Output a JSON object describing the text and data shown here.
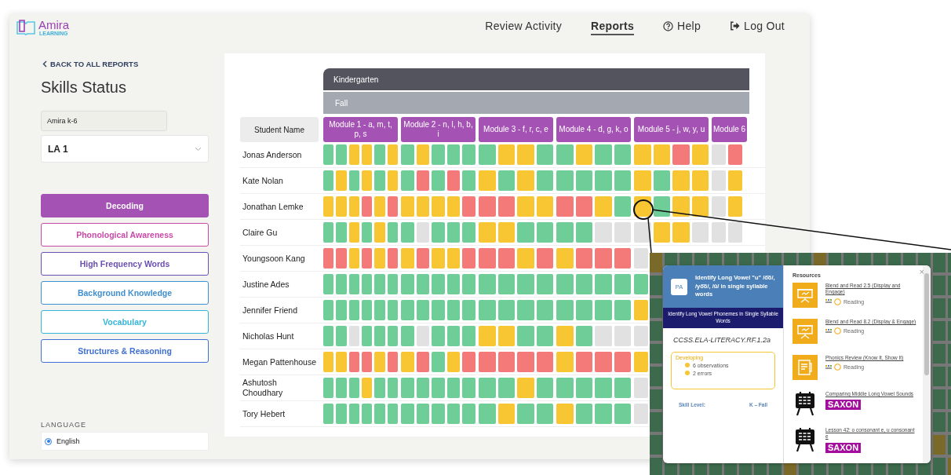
{
  "logo": {
    "name": "Amira",
    "tagline": "LEARNING"
  },
  "nav": [
    {
      "label": "Review Activity",
      "kind": "text",
      "selected": false
    },
    {
      "label": "Reports",
      "kind": "text",
      "selected": true
    },
    {
      "label": "Help",
      "kind": "help",
      "selected": false
    },
    {
      "label": "Log Out",
      "kind": "logout",
      "selected": false
    }
  ],
  "sidebar": {
    "back_link": "BACK TO ALL REPORTS",
    "title": "Skills Status",
    "program_field": "Amira k-6",
    "class_select": "LA 1",
    "skills": [
      {
        "label": "Decoding",
        "color": "#a552b5",
        "selected": true
      },
      {
        "label": "Phonological Awareness",
        "color": "#c94aa8",
        "selected": false
      },
      {
        "label": "High Frequency Words",
        "color": "#6a4fb0",
        "selected": false
      },
      {
        "label": "Background Knowledge",
        "color": "#3f8fd0",
        "selected": false
      },
      {
        "label": "Vocabulary",
        "color": "#35b5d8",
        "selected": false
      },
      {
        "label": "Structures & Reasoning",
        "color": "#3f6fd0",
        "selected": false
      }
    ],
    "language": {
      "label": "LANGUAGE",
      "options": [
        {
          "label": "English",
          "selected": true
        }
      ]
    }
  },
  "grid": {
    "grade": "Kindergarten",
    "season": "Fall",
    "name_header": "Student Name",
    "modules": [
      "Module 1 - a, m, t, p, s",
      "Module 2 - n, l, h, b, i",
      "Module 3 - f, r, c, e",
      "Module 4 - d, g, k, o",
      "Module 5 - j, w, y, u",
      "Module 6"
    ],
    "rows": [
      {
        "name": "Jonas Anderson",
        "cells": [
          [
            {
              "color": "#6fcd98"
            },
            {
              "color": "#6fcd98"
            },
            {
              "color": "#f8c633"
            },
            {
              "color": "#f8c633"
            },
            {
              "color": "#6fcd98"
            },
            {
              "color": "#f8c633"
            }
          ],
          [
            {
              "color": "#6fcd98"
            },
            {
              "color": "#f8c633"
            },
            {
              "color": "#6fcd98"
            },
            {
              "color": "#6fcd98"
            },
            {
              "color": "#6fcd98"
            }
          ],
          [
            {
              "color": "#6fcd98"
            },
            {
              "color": "#f8c633"
            },
            {
              "color": "#f8c633"
            },
            {
              "color": "#6fcd98"
            }
          ],
          [
            {
              "color": "#6fcd98"
            },
            {
              "color": "#f8c633"
            },
            {
              "color": "#6fcd98"
            },
            {
              "color": "#6fcd98"
            }
          ],
          [
            {
              "color": "#f8c633"
            },
            {
              "color": "#f8c633"
            },
            {
              "color": "#f47a7a"
            },
            {
              "color": "#f8c633"
            }
          ],
          [
            {
              "color": "#e1e1e1"
            },
            {
              "color": "#f47a7a"
            }
          ]
        ]
      },
      {
        "name": "Kate Nolan",
        "cells": [
          [
            {
              "color": "#6fcd98"
            },
            {
              "color": "#f8c633"
            },
            {
              "color": "#6fcd98"
            },
            {
              "color": "#f8c633"
            },
            {
              "color": "#6fcd98"
            },
            {
              "color": "#f8c633"
            }
          ],
          [
            {
              "color": "#6fcd98"
            },
            {
              "color": "#f47a7a"
            },
            {
              "color": "#6fcd98"
            },
            {
              "color": "#f47a7a"
            },
            {
              "color": "#6fcd98"
            }
          ],
          [
            {
              "color": "#f8c633"
            },
            {
              "color": "#6fcd98"
            },
            {
              "color": "#f8c633"
            },
            {
              "color": "#6fcd98"
            }
          ],
          [
            {
              "color": "#6fcd98"
            },
            {
              "color": "#6fcd98"
            },
            {
              "color": "#6fcd98"
            },
            {
              "color": "#6fcd98"
            }
          ],
          [
            {
              "color": "#f8c633"
            },
            {
              "color": "#6fcd98"
            },
            {
              "color": "#f8c633"
            },
            {
              "color": "#f8c633"
            }
          ],
          [
            {
              "color": "#e1e1e1"
            },
            {
              "color": "#f8c633"
            }
          ]
        ]
      },
      {
        "name": "Jonathan Lemke",
        "cells": [
          [
            {
              "color": "#f8c633"
            },
            {
              "color": "#f8c633"
            },
            {
              "color": "#f8c633"
            },
            {
              "color": "#f47a7a"
            },
            {
              "color": "#f8c633"
            },
            {
              "color": "#f47a7a"
            }
          ],
          [
            {
              "color": "#f8c633"
            },
            {
              "color": "#f8c633"
            },
            {
              "color": "#f8c633"
            },
            {
              "color": "#f8c633"
            },
            {
              "color": "#f47a7a"
            }
          ],
          [
            {
              "color": "#f47a7a"
            },
            {
              "color": "#f47a7a"
            },
            {
              "color": "#f8c633"
            },
            {
              "color": "#f8c633"
            }
          ],
          [
            {
              "color": "#f47a7a"
            },
            {
              "color": "#f47a7a"
            },
            {
              "color": "#f8c633"
            },
            {
              "color": "#6fcd98"
            }
          ],
          [
            {
              "color": "#f8c633"
            },
            {
              "color": "#6fcd98"
            },
            {
              "color": "#f8c633"
            },
            {
              "color": "#f8c633"
            }
          ],
          [
            {
              "color": "#e1e1e1"
            },
            {
              "color": "#f8c633"
            }
          ]
        ]
      },
      {
        "name": "Claire Gu",
        "cells": [
          [
            {
              "color": "#6fcd98"
            },
            {
              "color": "#6fcd98"
            },
            {
              "color": "#f8c633"
            },
            {
              "color": "#6fcd98"
            },
            {
              "color": "#f8c633"
            },
            {
              "color": "#6fcd98"
            }
          ],
          [
            {
              "color": "#6fcd98"
            },
            {
              "color": "#e1e1e1"
            },
            {
              "color": "#6fcd98"
            },
            {
              "color": "#6fcd98"
            },
            {
              "color": "#6fcd98"
            }
          ],
          [
            {
              "color": "#f8c633"
            },
            {
              "color": "#f8c633"
            },
            {
              "color": "#6fcd98"
            },
            {
              "color": "#6fcd98"
            }
          ],
          [
            {
              "color": "#6fcd98"
            },
            {
              "color": "#6fcd98"
            },
            {
              "color": "#e1e1e1"
            },
            {
              "color": "#e1e1e1"
            }
          ],
          [
            {
              "color": "#e1e1e1"
            },
            {
              "color": "#f8c633"
            },
            {
              "color": "#f8c633"
            },
            {
              "color": "#e1e1e1"
            }
          ],
          [
            {
              "color": "#e1e1e1"
            },
            {
              "color": "#e1e1e1"
            }
          ]
        ]
      },
      {
        "name": "Youngsoon Kang",
        "cells": [
          [
            {
              "color": "#f47a7a"
            },
            {
              "color": "#f47a7a"
            },
            {
              "color": "#f8c633"
            },
            {
              "color": "#f47a7a"
            },
            {
              "color": "#f8c633"
            },
            {
              "color": "#f47a7a"
            }
          ],
          [
            {
              "color": "#f8c633"
            },
            {
              "color": "#f47a7a"
            },
            {
              "color": "#f8c633"
            },
            {
              "color": "#f8c633"
            },
            {
              "color": "#f47a7a"
            }
          ],
          [
            {
              "color": "#f47a7a"
            },
            {
              "color": "#f47a7a"
            },
            {
              "color": "#f8c633"
            },
            {
              "color": "#f47a7a"
            }
          ],
          [
            {
              "color": "#f8c633"
            },
            {
              "color": "#f47a7a"
            },
            {
              "color": "#f47a7a"
            },
            {
              "color": "#f47a7a"
            }
          ],
          [
            {
              "color": "#e1e1e1"
            }
          ]
        ]
      },
      {
        "name": "Justine Ades",
        "cells": [
          [
            {
              "color": "#6fcd98"
            },
            {
              "color": "#6fcd98"
            },
            {
              "color": "#6fcd98"
            },
            {
              "color": "#6fcd98"
            },
            {
              "color": "#6fcd98"
            },
            {
              "color": "#6fcd98"
            }
          ],
          [
            {
              "color": "#6fcd98"
            },
            {
              "color": "#6fcd98"
            },
            {
              "color": "#6fcd98"
            },
            {
              "color": "#6fcd98"
            },
            {
              "color": "#6fcd98"
            }
          ],
          [
            {
              "color": "#6fcd98"
            },
            {
              "color": "#6fcd98"
            },
            {
              "color": "#6fcd98"
            },
            {
              "color": "#6fcd98"
            }
          ],
          [
            {
              "color": "#6fcd98"
            },
            {
              "color": "#6fcd98"
            },
            {
              "color": "#6fcd98"
            },
            {
              "color": "#6fcd98"
            }
          ],
          [
            {
              "color": "#6fcd98"
            }
          ]
        ]
      },
      {
        "name": "Jennifer Friend",
        "cells": [
          [
            {
              "color": "#6fcd98"
            },
            {
              "color": "#6fcd98"
            },
            {
              "color": "#6fcd98"
            },
            {
              "color": "#6fcd98"
            },
            {
              "color": "#6fcd98"
            },
            {
              "color": "#6fcd98"
            }
          ],
          [
            {
              "color": "#6fcd98"
            },
            {
              "color": "#6fcd98"
            },
            {
              "color": "#6fcd98"
            },
            {
              "color": "#6fcd98"
            },
            {
              "color": "#6fcd98"
            }
          ],
          [
            {
              "color": "#6fcd98"
            },
            {
              "color": "#6fcd98"
            },
            {
              "color": "#6fcd98"
            },
            {
              "color": "#6fcd98"
            }
          ],
          [
            {
              "color": "#6fcd98"
            },
            {
              "color": "#6fcd98"
            },
            {
              "color": "#6fcd98"
            },
            {
              "color": "#6fcd98"
            }
          ],
          [
            {
              "color": "#f8c633"
            }
          ]
        ]
      },
      {
        "name": "Nicholas Hunt",
        "cells": [
          [
            {
              "color": "#6fcd98"
            },
            {
              "color": "#6fcd98"
            },
            {
              "color": "#e1e1e1"
            },
            {
              "color": "#6fcd98"
            },
            {
              "color": "#6fcd98"
            },
            {
              "color": "#6fcd98"
            }
          ],
          [
            {
              "color": "#6fcd98"
            },
            {
              "color": "#e1e1e1"
            },
            {
              "color": "#6fcd98"
            },
            {
              "color": "#6fcd98"
            },
            {
              "color": "#6fcd98"
            }
          ],
          [
            {
              "color": "#f8c633"
            },
            {
              "color": "#f8c633"
            },
            {
              "color": "#6fcd98"
            },
            {
              "color": "#6fcd98"
            }
          ],
          [
            {
              "color": "#f8c633"
            },
            {
              "color": "#6fcd98"
            },
            {
              "color": "#e1e1e1"
            },
            {
              "color": "#e1e1e1"
            }
          ],
          [
            {
              "color": "#e1e1e1"
            }
          ]
        ]
      },
      {
        "name": "Megan Pattenhouse",
        "cells": [
          [
            {
              "color": "#f8c633"
            },
            {
              "color": "#f8c633"
            },
            {
              "color": "#f47a7a"
            },
            {
              "color": "#f47a7a"
            },
            {
              "color": "#f8c633"
            },
            {
              "color": "#f47a7a"
            }
          ],
          [
            {
              "color": "#f8c633"
            },
            {
              "color": "#f47a7a"
            },
            {
              "color": "#6fcd98"
            },
            {
              "color": "#f8c633"
            },
            {
              "color": "#f47a7a"
            }
          ],
          [
            {
              "color": "#f47a7a"
            },
            {
              "color": "#f47a7a"
            },
            {
              "color": "#f47a7a"
            },
            {
              "color": "#f47a7a"
            }
          ],
          [
            {
              "color": "#f8c633"
            },
            {
              "color": "#f47a7a"
            },
            {
              "color": "#f47a7a"
            },
            {
              "color": "#f47a7a"
            }
          ],
          [
            {
              "color": "#f8c633"
            }
          ]
        ]
      },
      {
        "name": "Ashutosh Choudhary",
        "cells": [
          [
            {
              "color": "#6fcd98"
            },
            {
              "color": "#6fcd98"
            },
            {
              "color": "#6fcd98"
            },
            {
              "color": "#f8c633"
            },
            {
              "color": "#6fcd98"
            },
            {
              "color": "#6fcd98"
            }
          ],
          [
            {
              "color": "#6fcd98"
            },
            {
              "color": "#6fcd98"
            },
            {
              "color": "#6fcd98"
            },
            {
              "color": "#6fcd98"
            },
            {
              "color": "#6fcd98"
            }
          ],
          [
            {
              "color": "#6fcd98"
            },
            {
              "color": "#6fcd98"
            },
            {
              "color": "#f8c633"
            },
            {
              "color": "#6fcd98"
            }
          ],
          [
            {
              "color": "#6fcd98"
            },
            {
              "color": "#6fcd98"
            },
            {
              "color": "#6fcd98"
            },
            {
              "color": "#6fcd98"
            }
          ],
          [
            {
              "color": "#e1e1e1"
            }
          ]
        ]
      },
      {
        "name": "Tory Hebert",
        "cells": [
          [
            {
              "color": "#6fcd98"
            },
            {
              "color": "#6fcd98"
            },
            {
              "color": "#6fcd98"
            },
            {
              "color": "#6fcd98"
            },
            {
              "color": "#6fcd98"
            },
            {
              "color": "#6fcd98"
            }
          ],
          [
            {
              "color": "#6fcd98"
            },
            {
              "color": "#6fcd98"
            },
            {
              "color": "#6fcd98"
            },
            {
              "color": "#6fcd98"
            },
            {
              "color": "#6fcd98"
            }
          ],
          [
            {
              "color": "#6fcd98"
            },
            {
              "color": "#f8c633"
            },
            {
              "color": "#6fcd98"
            },
            {
              "color": "#6fcd98"
            }
          ],
          [
            {
              "color": "#f8c633"
            },
            {
              "color": "#6fcd98"
            },
            {
              "color": "#6fcd98"
            },
            {
              "color": "#6fcd98"
            }
          ],
          [
            {
              "color": "#e1e1e1"
            }
          ]
        ]
      }
    ]
  },
  "popup": {
    "badge": "PA",
    "title": "Identify Long Vowel \"u\" /o͞o/, /yo͞o/, /ū/ in single syllable words",
    "subtitle": "Identify Long Vowel Phonemes in Single Syllable Words",
    "standard": "CCSS.ELA-LITERACY.RF.1.2a",
    "status": {
      "label": "Developing",
      "items": [
        "6 observations",
        "2 errors"
      ]
    },
    "skill_level": {
      "label": "Skill Level:",
      "value": "K – Fall"
    },
    "close": "×",
    "resources_title": "Resources",
    "resources": [
      {
        "title": "Blend and Read 2.5 (Display and Engage)",
        "kind": "display",
        "provider": {
          "kind": "reading",
          "label": "Reading"
        }
      },
      {
        "title": "Blend and Read 8.2 (Display & Engage)",
        "kind": "display",
        "provider": {
          "kind": "reading",
          "label": "Reading"
        }
      },
      {
        "title": "Phonics Review (Know It, Show It)",
        "kind": "book",
        "provider": {
          "kind": "reading",
          "label": "Reading"
        }
      },
      {
        "title": "Comparing Middle Long Vowel Sounds",
        "kind": "chalkboard",
        "provider": {
          "kind": "saxon",
          "label": "SAXON"
        }
      },
      {
        "title": "Lesson 42: o consonant e, u consonant e",
        "kind": "chalkboard",
        "provider": {
          "kind": "saxon",
          "label": "SAXON"
        }
      }
    ]
  }
}
